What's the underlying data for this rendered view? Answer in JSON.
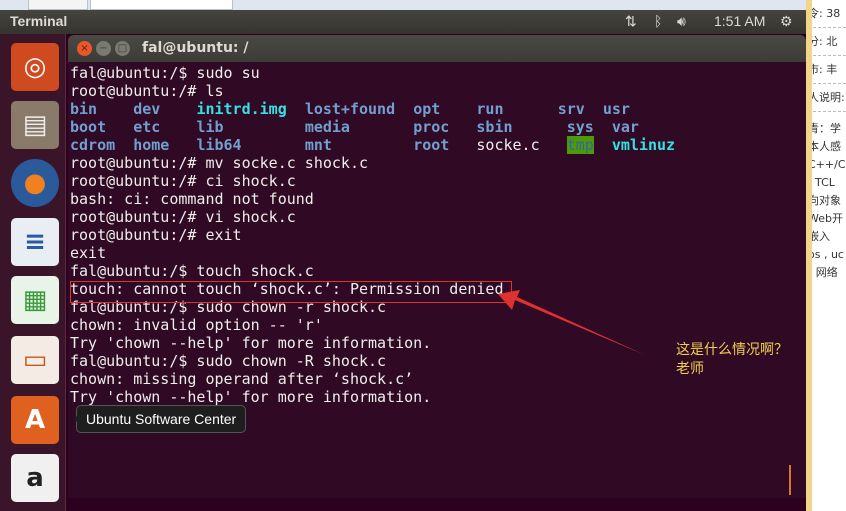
{
  "panel": {
    "title": "Terminal",
    "time": "1:51 AM"
  },
  "window": {
    "title": "fal@ubuntu: /"
  },
  "launcher": {
    "tooltip": "Ubuntu Software Center",
    "items": [
      "ubuntu-dash",
      "files",
      "firefox",
      "libreoffice-writer",
      "libreoffice-calc",
      "libreoffice-impress",
      "ubuntu-software-center",
      "amazon"
    ]
  },
  "terminal": {
    "lines": [
      [
        {
          "t": "fal@ubuntu:/$ sudo su"
        }
      ],
      [
        {
          "t": "root@ubuntu:/# ls"
        }
      ],
      [
        {
          "t": "bin",
          "c": "dir"
        },
        {
          "t": "    "
        },
        {
          "t": "dev",
          "c": "dir"
        },
        {
          "t": "    "
        },
        {
          "t": "initrd.img",
          "c": "lnk"
        },
        {
          "t": "  "
        },
        {
          "t": "lost+found",
          "c": "dir"
        },
        {
          "t": "  "
        },
        {
          "t": "opt",
          "c": "dir"
        },
        {
          "t": "    "
        },
        {
          "t": "run",
          "c": "dir"
        },
        {
          "t": "      "
        },
        {
          "t": "srv",
          "c": "dir"
        },
        {
          "t": "  "
        },
        {
          "t": "usr",
          "c": "dir"
        }
      ],
      [
        {
          "t": "boot",
          "c": "dir"
        },
        {
          "t": "   "
        },
        {
          "t": "etc",
          "c": "dir"
        },
        {
          "t": "    "
        },
        {
          "t": "lib",
          "c": "dir"
        },
        {
          "t": "         "
        },
        {
          "t": "media",
          "c": "dir"
        },
        {
          "t": "       "
        },
        {
          "t": "proc",
          "c": "dir"
        },
        {
          "t": "   "
        },
        {
          "t": "sbin",
          "c": "dir"
        },
        {
          "t": "      "
        },
        {
          "t": "sys",
          "c": "dir"
        },
        {
          "t": "  "
        },
        {
          "t": "var",
          "c": "dir"
        }
      ],
      [
        {
          "t": "cdrom",
          "c": "dir"
        },
        {
          "t": "  "
        },
        {
          "t": "home",
          "c": "dir"
        },
        {
          "t": "   "
        },
        {
          "t": "lib64",
          "c": "dir"
        },
        {
          "t": "       "
        },
        {
          "t": "mnt",
          "c": "dir"
        },
        {
          "t": "         "
        },
        {
          "t": "root",
          "c": "dir"
        },
        {
          "t": "   "
        },
        {
          "t": "socke.c"
        },
        {
          "t": "   "
        },
        {
          "t": "tmp",
          "c": "tmp"
        },
        {
          "t": "  "
        },
        {
          "t": "vmlinuz",
          "c": "lnk"
        }
      ],
      [
        {
          "t": "root@ubuntu:/# mv socke.c shock.c"
        }
      ],
      [
        {
          "t": "root@ubuntu:/# ci shock.c"
        }
      ],
      [
        {
          "t": "bash: ci: command not found"
        }
      ],
      [
        {
          "t": "root@ubuntu:/# vi shock.c"
        }
      ],
      [
        {
          "t": "root@ubuntu:/# exit"
        }
      ],
      [
        {
          "t": "exit"
        }
      ],
      [
        {
          "t": "fal@ubuntu:/$ touch shock.c"
        }
      ],
      [
        {
          "t": "touch: cannot touch ‘shock.c’: Permission denied"
        }
      ],
      [
        {
          "t": "fal@ubuntu:/$ sudo chown -r shock.c"
        }
      ],
      [
        {
          "t": "chown: invalid option -- 'r'"
        }
      ],
      [
        {
          "t": "Try 'chown --help' for more information."
        }
      ],
      [
        {
          "t": "fal@ubuntu:/$ sudo chown -R shock.c"
        }
      ],
      [
        {
          "t": "chown: missing operand after ‘shock.c’"
        }
      ],
      [
        {
          "t": "Try 'chown --help' for more information."
        }
      ]
    ]
  },
  "annotation": {
    "line1": "这是什么情况啊？",
    "line2": "老师",
    "color": "#e03030"
  },
  "side": {
    "lines": [
      "令: 38",
      "分: 北",
      "市: 丰",
      "人说明:",
      "青：学",
      "本人感",
      "C++/C",
      ", TCL",
      "向对象",
      "Web开",
      "嵌入",
      "os , uc",
      ") 网络"
    ]
  }
}
